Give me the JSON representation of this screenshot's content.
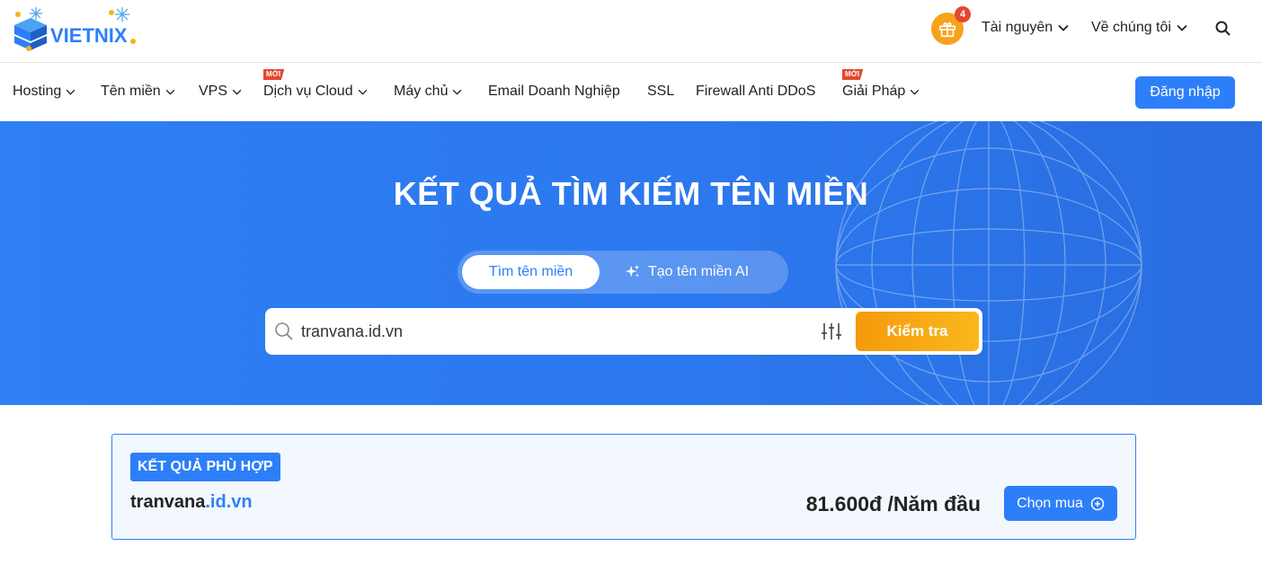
{
  "header": {
    "logo_text": "VIETNIX",
    "gift_count": "4",
    "links": [
      {
        "label": "Tài nguyên",
        "icon": "chevron-down-icon"
      },
      {
        "label": "Về chúng tôi",
        "icon": "chevron-down-icon"
      }
    ],
    "search_icon": "search-icon"
  },
  "nav": {
    "items": [
      {
        "label": "Hosting",
        "dropdown": true
      },
      {
        "label": "Tên miền",
        "dropdown": true
      },
      {
        "label": "VPS",
        "dropdown": true
      },
      {
        "label": "Dịch vụ Cloud",
        "dropdown": true,
        "badge": "MỚI"
      },
      {
        "label": "Máy chủ",
        "dropdown": true
      },
      {
        "label": "Email Doanh Nghiệp",
        "dropdown": false
      },
      {
        "label": "SSL",
        "dropdown": false
      },
      {
        "label": "Firewall Anti DDoS",
        "dropdown": false
      },
      {
        "label": "Giải Pháp",
        "dropdown": true,
        "badge": "MỚI"
      }
    ],
    "login_label": "Đăng nhập"
  },
  "hero": {
    "title": "KẾT QUẢ TÌM KIẾM TÊN MIỀN",
    "tab_search": "Tìm tên miền",
    "tab_ai": "Tạo tên miền AI",
    "search_value": "tranvana.id.vn",
    "check_label": "Kiểm tra"
  },
  "result": {
    "tag": "KẾT QUẢ PHÙ HỢP",
    "domain_name": "tranvana",
    "domain_tld": ".id.vn",
    "price": "81.600đ /Năm đầu",
    "buy_label": "Chọn mua"
  },
  "colors": {
    "primary": "#2d7ff9",
    "accent": "#f7a21b",
    "badge": "#e5482f"
  }
}
